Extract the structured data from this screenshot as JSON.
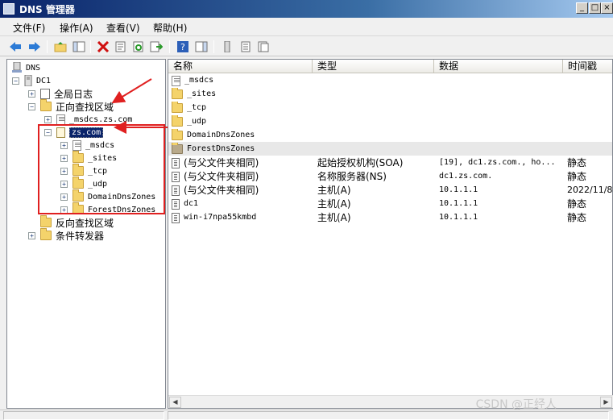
{
  "window": {
    "title": "DNS 管理器"
  },
  "menu": [
    "文件(F)",
    "操作(A)",
    "查看(V)",
    "帮助(H)"
  ],
  "tree": {
    "root": "DNS",
    "server": "DC1",
    "items": [
      {
        "label": "全局日志"
      },
      {
        "label": "正向查找区域"
      },
      {
        "label": "_msdcs.zs.com"
      },
      {
        "label": "zs.com"
      },
      {
        "label": "_msdcs"
      },
      {
        "label": "_sites"
      },
      {
        "label": "_tcp"
      },
      {
        "label": "_udp"
      },
      {
        "label": "DomainDnsZones"
      },
      {
        "label": "ForestDnsZones"
      },
      {
        "label": "反向查找区域"
      },
      {
        "label": "条件转发器"
      }
    ]
  },
  "list": {
    "columns": [
      "名称",
      "类型",
      "数据",
      "时间戳"
    ],
    "rows": [
      {
        "name": "_msdcs",
        "type": "",
        "data": "",
        "time": ""
      },
      {
        "name": "_sites",
        "type": "",
        "data": "",
        "time": ""
      },
      {
        "name": "_tcp",
        "type": "",
        "data": "",
        "time": ""
      },
      {
        "name": "_udp",
        "type": "",
        "data": "",
        "time": ""
      },
      {
        "name": "DomainDnsZones",
        "type": "",
        "data": "",
        "time": ""
      },
      {
        "name": "ForestDnsZones",
        "type": "",
        "data": "",
        "time": ""
      },
      {
        "name": "(与父文件夹相同)",
        "type": "起始授权机构(SOA)",
        "data": "[19], dc1.zs.com., ho...",
        "time": "静态"
      },
      {
        "name": "(与父文件夹相同)",
        "type": "名称服务器(NS)",
        "data": "dc1.zs.com.",
        "time": "静态"
      },
      {
        "name": "(与父文件夹相同)",
        "type": "主机(A)",
        "data": "10.1.1.1",
        "time": "2022/11/8"
      },
      {
        "name": "dc1",
        "type": "主机(A)",
        "data": "10.1.1.1",
        "time": "静态"
      },
      {
        "name": "win-i7npa55kmbd",
        "type": "主机(A)",
        "data": "10.1.1.1",
        "time": "静态"
      }
    ]
  },
  "watermark": "CSDN @正经人",
  "colors": {
    "highlight_box": "#e02020",
    "selection": "#0a246a"
  }
}
